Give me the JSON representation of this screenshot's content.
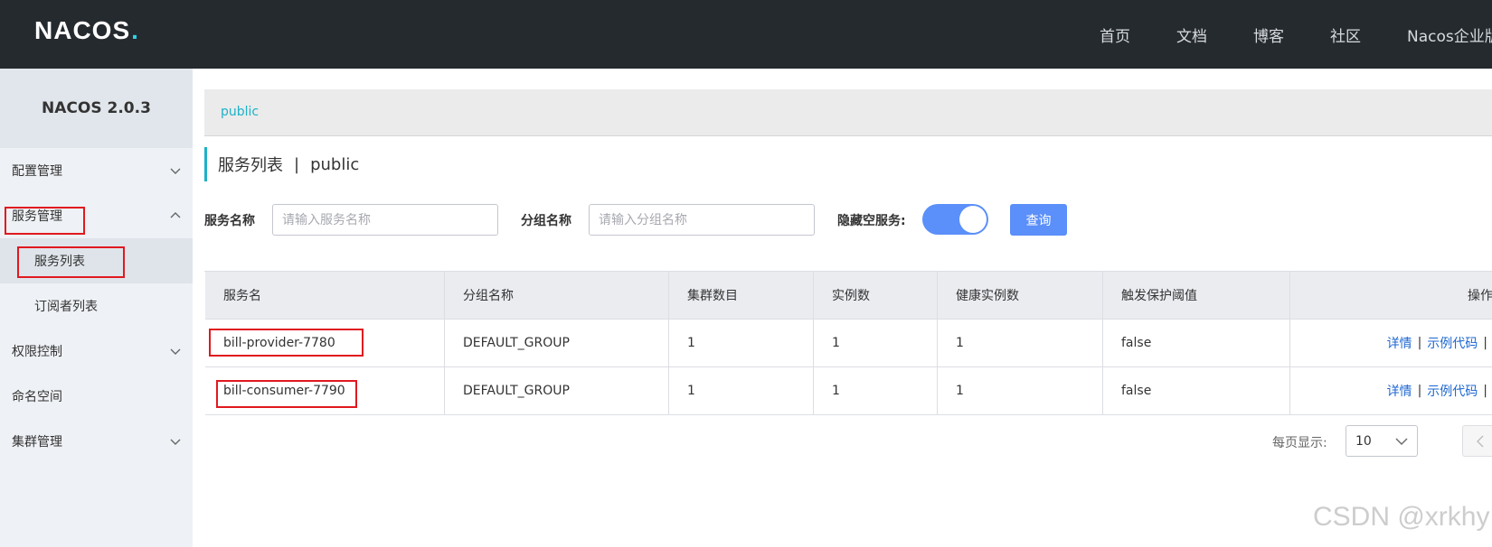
{
  "header": {
    "logo_main": "NACOS",
    "logo_dot": ".",
    "nav": [
      "首页",
      "文档",
      "博客",
      "社区",
      "Nacos企业版"
    ]
  },
  "sidebar": {
    "version": "NACOS 2.0.3",
    "items": [
      {
        "label": "配置管理",
        "expanded": false
      },
      {
        "label": "服务管理",
        "expanded": true
      },
      {
        "label": "服务列表",
        "active": true
      },
      {
        "label": "订阅者列表"
      },
      {
        "label": "权限控制",
        "expanded": false
      },
      {
        "label": "命名空间"
      },
      {
        "label": "集群管理",
        "expanded": false
      }
    ]
  },
  "breadcrumb": {
    "namespace": "public"
  },
  "page": {
    "title": "服务列表",
    "separator": "|",
    "namespace": "public"
  },
  "filters": {
    "service_name_label": "服务名称",
    "service_name_placeholder": "请输入服务名称",
    "group_name_label": "分组名称",
    "group_name_placeholder": "请输入分组名称",
    "hide_empty_label": "隐藏空服务:",
    "hide_empty_on": true,
    "query_button": "查询"
  },
  "table": {
    "columns": [
      "服务名",
      "分组名称",
      "集群数目",
      "实例数",
      "健康实例数",
      "触发保护阈值",
      "操作"
    ],
    "rows": [
      {
        "service": "bill-provider-7780",
        "group": "DEFAULT_GROUP",
        "clusters": "1",
        "instances": "1",
        "healthy": "1",
        "threshold": "false",
        "op_detail": "详情",
        "op_code": "示例代码"
      },
      {
        "service": "bill-consumer-7790",
        "group": "DEFAULT_GROUP",
        "clusters": "1",
        "instances": "1",
        "healthy": "1",
        "threshold": "false",
        "op_detail": "详情",
        "op_code": "示例代码"
      }
    ],
    "op_separator": "|"
  },
  "pagination": {
    "page_size_label": "每页显示:",
    "page_size": "10"
  },
  "watermark": "CSDN @xrkhy",
  "colors": {
    "accent": "#1db1c8",
    "primary": "#5b8ff9",
    "link": "#1d67d0",
    "highlight": "#e0191f"
  }
}
